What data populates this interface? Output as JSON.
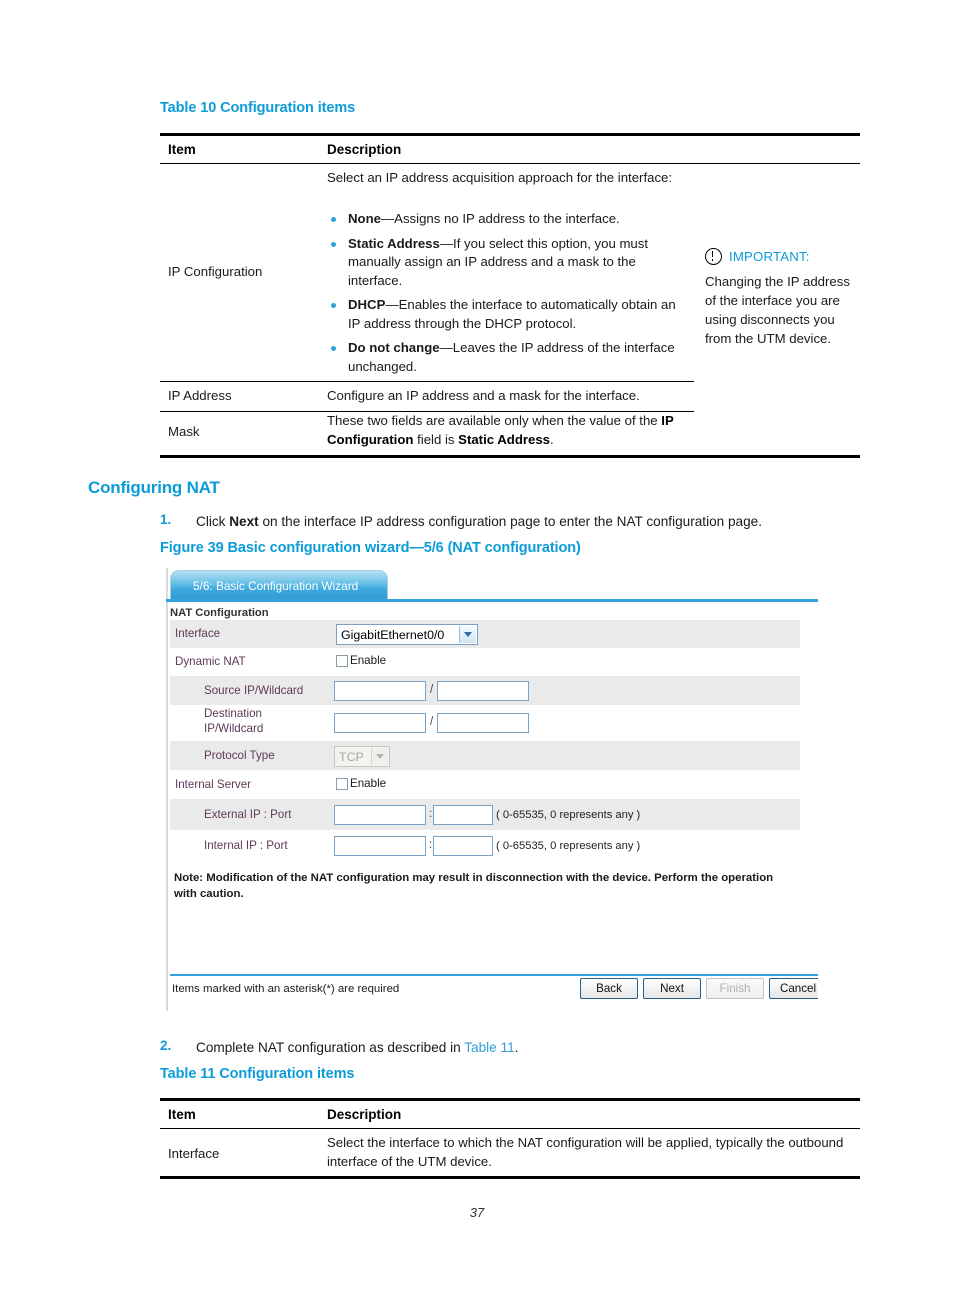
{
  "document": {
    "page_number": "37"
  },
  "table10": {
    "caption": "Table 10 Configuration items",
    "headers": {
      "item": "Item",
      "description": "Description"
    },
    "rows": [
      {
        "item": "IP Configuration",
        "intro": "Select an IP address acquisition approach for the interface:",
        "bullets": [
          {
            "term": "None",
            "dash": "—",
            "text": "Assigns no IP address to the interface."
          },
          {
            "term": "Static Address",
            "dash": "—",
            "text": "If you select this option, you must manually assign an IP address and a mask to the interface."
          },
          {
            "term": "DHCP",
            "dash": "—",
            "text": "Enables the interface to automatically obtain an IP address through the DHCP protocol."
          },
          {
            "term": "Do not change",
            "dash": "—",
            "text": "Leaves the IP address of the interface unchanged."
          }
        ]
      },
      {
        "item": "IP Address",
        "description": "Configure an IP address and a mask for the interface."
      },
      {
        "item": "Mask",
        "description_a": "These two fields are available only when the value of the ",
        "description_b": "IP Configuration",
        "description_c": " field is ",
        "description_d": "Static Address",
        "description_e": "."
      }
    ],
    "important": {
      "icon": "exclamation-circle-icon",
      "label": "IMPORTANT:",
      "text": "Changing the IP address of the interface you are using disconnects you from the UTM device."
    }
  },
  "section": {
    "heading": "Configuring NAT",
    "step1": {
      "num": "1.",
      "a": "Click ",
      "b": "Next",
      "c": " on the interface IP address configuration page to enter the NAT configuration page."
    },
    "figure_caption": "Figure 39 Basic configuration wizard—5/6 (NAT configuration)",
    "step2": {
      "num": "2.",
      "a": "Complete NAT configuration as described in ",
      "link": "Table 11",
      "c": "."
    }
  },
  "wizard": {
    "tab_label": "5/6: Basic Configuration Wizard",
    "section_title": "NAT Configuration",
    "fields": {
      "interface": {
        "label": "Interface",
        "value": "GigabitEthernet0/0"
      },
      "dynamic_nat": {
        "label": "Dynamic NAT",
        "checkbox_label": "Enable",
        "checked": false
      },
      "source_ip": {
        "label": "Source IP/Wildcard",
        "ip": "",
        "wildcard": "",
        "separator": "/"
      },
      "destination_ip": {
        "label_line1": "Destination",
        "label_line2": "IP/Wildcard",
        "ip": "",
        "wildcard": "",
        "separator": "/"
      },
      "protocol_type": {
        "label": "Protocol Type",
        "value": "TCP",
        "disabled": true
      },
      "internal_server": {
        "label": "Internal Server",
        "checkbox_label": "Enable",
        "checked": false
      },
      "external_ip_port": {
        "label": "External IP : Port",
        "ip": "",
        "port": "",
        "separator": ":",
        "hint": "( 0-65535, 0 represents any )"
      },
      "internal_ip_port": {
        "label": "Internal IP : Port",
        "ip": "",
        "port": "",
        "separator": ":",
        "hint": "( 0-65535, 0 represents any )"
      }
    },
    "note": "Note: Modification of the NAT configuration may result in disconnection with the device. Perform the operation with caution.",
    "footer_note": "Items marked with an asterisk(*) are required",
    "buttons": [
      {
        "label": "Back",
        "disabled": false
      },
      {
        "label": "Next",
        "disabled": false
      },
      {
        "label": "Finish",
        "disabled": true
      },
      {
        "label": "Cancel",
        "disabled": false
      }
    ]
  },
  "table11": {
    "caption": "Table 11 Configuration items",
    "headers": {
      "item": "Item",
      "description": "Description"
    },
    "rows": [
      {
        "item": "Interface",
        "description": "Select the interface to which the NAT configuration will be applied, typically the outbound interface of the UTM device."
      }
    ]
  }
}
